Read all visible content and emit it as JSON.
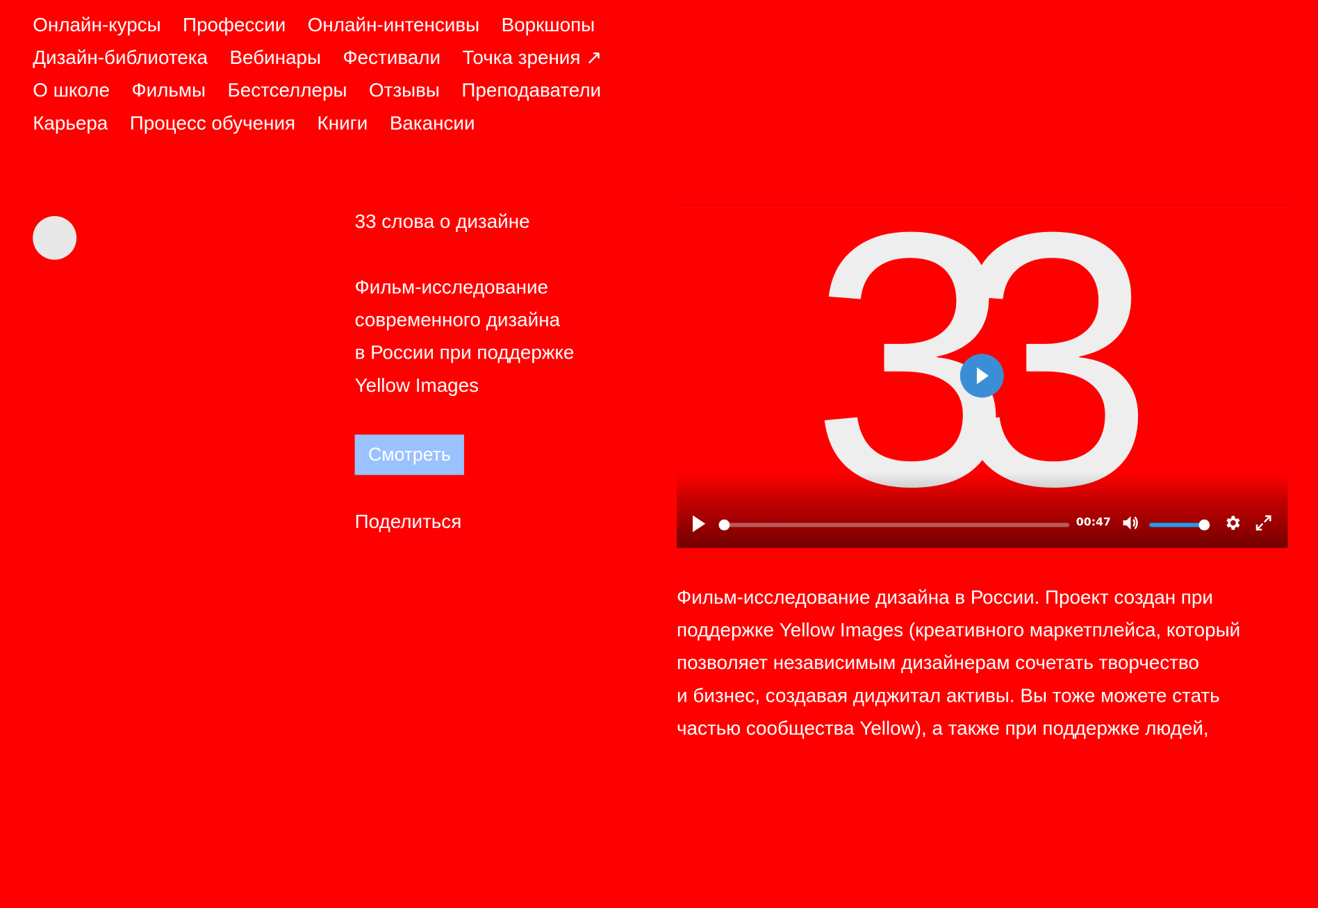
{
  "nav": {
    "rows": [
      [
        "Онлайн-курсы",
        "Профессии",
        "Онлайн-интенсивы",
        "Воркшопы"
      ],
      [
        "Дизайн-библиотека",
        "Вебинары",
        "Фестивали",
        "Точка зрения ↗"
      ],
      [
        "О школе",
        "Фильмы",
        "Бестселлеры",
        "Отзывы",
        "Преподаватели"
      ],
      [
        "Карьера",
        "Процесс обучения",
        "Книги",
        "Вакансии"
      ]
    ]
  },
  "film": {
    "title": "33 слова о дизайне",
    "description_lines": [
      "Фильм-исследование",
      "современного дизайна",
      "в России при поддержке",
      "Yellow Images"
    ],
    "watch_label": "Смотреть",
    "share_label": "Поделиться"
  },
  "video": {
    "poster_text": "33",
    "time": "00:47",
    "progress": 0.0,
    "volume": 1.0
  },
  "about": {
    "lines": [
      "Фильм-исследование дизайна в России. Проект создан при",
      "поддержке Yellow Images (креативного маркетплейса, который",
      "позволяет независимым дизайнерам сочетать творчество",
      "и бизнес, создавая диджитал активы. Вы тоже можете стать",
      "частью сообщества Yellow), а также при поддержке людей,"
    ]
  },
  "colors": {
    "background": "#ff0000",
    "button": "#99c2ff",
    "player_accent": "#1f9cf0",
    "play_circle": "#3b8ed6"
  }
}
